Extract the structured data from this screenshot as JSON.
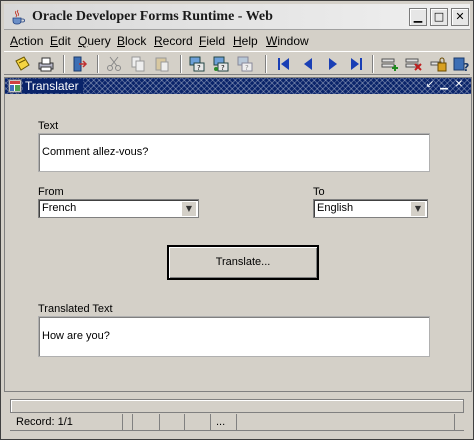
{
  "window": {
    "title": "Oracle Developer Forms Runtime - Web"
  },
  "window_controls": {
    "minimize": "▁",
    "maximize": "□",
    "close": "✕"
  },
  "menu": [
    {
      "pre": "",
      "key": "A",
      "rest": "ction"
    },
    {
      "pre": "",
      "key": "E",
      "rest": "dit"
    },
    {
      "pre": "",
      "key": "Q",
      "rest": "uery"
    },
    {
      "pre": "",
      "key": "B",
      "rest": "lock"
    },
    {
      "pre": "",
      "key": "R",
      "rest": "ecord"
    },
    {
      "pre": "",
      "key": "F",
      "rest": "ield"
    },
    {
      "pre": "",
      "key": "H",
      "rest": "elp"
    },
    {
      "pre": "",
      "key": "W",
      "rest": "indow"
    }
  ],
  "toolbar_icons": [
    "save-icon",
    "print-icon",
    "exit-icon",
    "cut-icon",
    "copy-icon",
    "paste-icon",
    "enter-query-icon",
    "execute-query-icon",
    "cancel-query-icon",
    "previous-block-icon",
    "previous-record-icon",
    "next-record-icon",
    "next-block-icon",
    "insert-record-icon",
    "delete-record-icon",
    "lock-record-icon",
    "help-icon"
  ],
  "form": {
    "title": "Translater",
    "text_label": "Text",
    "text_value": "Comment allez-vous?",
    "from_label": "From",
    "from_value": "French",
    "to_label": "To",
    "to_value": "English",
    "translate_button": "Translate...",
    "translated_label": "Translated Text",
    "translated_value": "How are you?"
  },
  "status": {
    "record": "Record: 1/1",
    "dots": "..."
  },
  "colors": {
    "form_titlebar": "#0a246a",
    "background": "#d4d0c8"
  }
}
